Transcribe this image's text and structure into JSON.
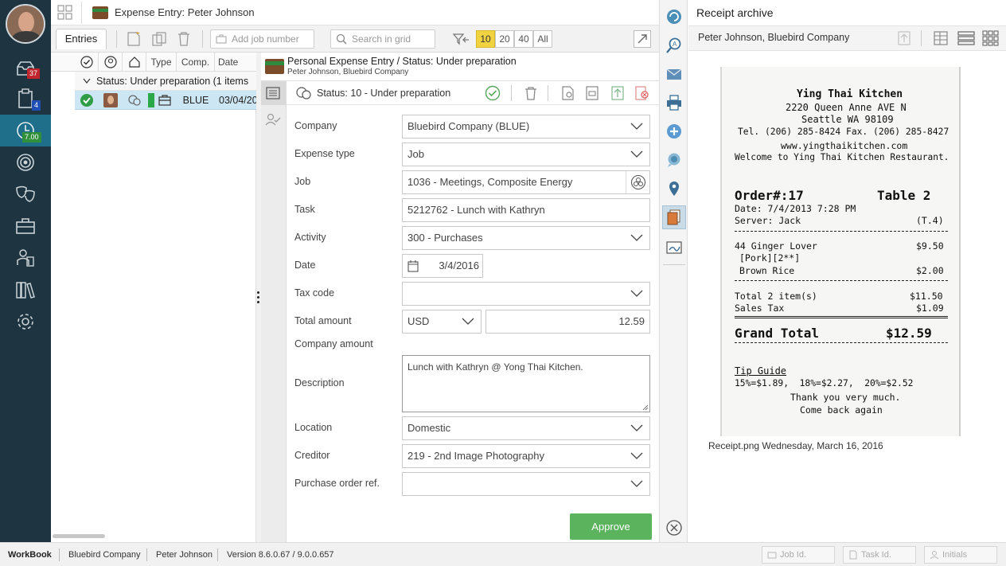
{
  "window": {
    "title": "Expense Entry: Peter Johnson"
  },
  "nav": {
    "items": [
      {
        "name": "inbox",
        "badge": "37",
        "badge_color": "#c0242d"
      },
      {
        "name": "clipboard",
        "badge": "4",
        "badge_color": "#1f4fb5"
      },
      {
        "name": "time",
        "badge": "7.00",
        "badge_color": "#2f8f3a",
        "active": true
      },
      {
        "name": "target"
      },
      {
        "name": "masks"
      },
      {
        "name": "briefcase"
      },
      {
        "name": "people"
      },
      {
        "name": "books"
      },
      {
        "name": "settings"
      }
    ]
  },
  "toolbar": {
    "entries_tab": "Entries",
    "add_job_placeholder": "Add job number",
    "search_placeholder": "Search in grid",
    "page_sizes": [
      "10",
      "20",
      "40",
      "All"
    ],
    "active_page_size": "10"
  },
  "grid": {
    "columns": [
      "Type",
      "Comp.",
      "Date"
    ],
    "group_label": "Status: Under preparation (1 items",
    "row": {
      "company": "BLUE",
      "date": "03/04/20"
    }
  },
  "form": {
    "header_title": "Personal Expense Entry / Status: Under preparation",
    "header_subtitle": "Peter Johnson, Bluebird Company",
    "status_text": "Status: 10 - Under preparation",
    "fields": {
      "company_label": "Company",
      "company_value": "Bluebird Company (BLUE)",
      "expense_type_label": "Expense type",
      "expense_type_value": "Job",
      "job_label": "Job",
      "job_value": "1036 - Meetings, Composite Energy",
      "task_label": "Task",
      "task_value": "5212762 - Lunch with Kathryn",
      "activity_label": "Activity",
      "activity_value": "300 - Purchases",
      "date_label": "Date",
      "date_value": "3/4/2016",
      "tax_code_label": "Tax code",
      "tax_code_value": "",
      "total_amount_label": "Total amount",
      "currency_value": "USD",
      "total_amount_value": "12.59",
      "company_amount_label": "Company amount",
      "description_label": "Description",
      "description_value": "Lunch with Kathryn @ Yong Thai Kitchen.",
      "location_label": "Location",
      "location_value": "Domestic",
      "creditor_label": "Creditor",
      "creditor_value": "219 - 2nd Image Photography",
      "po_label": "Purchase order ref.",
      "po_value": ""
    },
    "approve_label": "Approve"
  },
  "archive": {
    "title": "Receipt archive",
    "owner": "Peter Johnson, Bluebird Company",
    "caption": "Receipt.png Wednesday, March 16, 2016",
    "receipt": {
      "l1": "Ying Thai Kitchen",
      "l2": "2220 Queen Anne AVE N",
      "l3": "Seattle WA 98109",
      "l4": "Tel. (206) 285-8424 Fax. (206) 285-8427",
      "l5": "www.yingthaikitchen.com",
      "l6": "Welcome to Ying Thai Kitchen Restaurant.",
      "order": "Order#:17",
      "table": "Table 2",
      "date": "Date: 7/4/2013 7:28 PM",
      "server": "Server: Jack",
      "server_code": "(T.4)",
      "item1": "44 Ginger Lover",
      "item1_price": "$9.50",
      "item1_sub": "[Pork][2**]",
      "item2": "Brown Rice",
      "item2_price": "$2.00",
      "total_items": "Total 2 item(s)",
      "total_items_price": "$11.50",
      "tax": "Sales Tax",
      "tax_price": "$1.09",
      "grand": "Grand Total",
      "grand_price": "$12.59",
      "tip_title": "Tip Guide",
      "tip_line": "15%=$1.89,  18%=$2.27,  20%=$2.52",
      "thanks": "Thank you very much.",
      "come": "Come back again"
    }
  },
  "statusbar": {
    "app": "WorkBook",
    "company": "Bluebird Company",
    "user": "Peter Johnson",
    "version": "Version 8.6.0.67 / 9.0.0.657",
    "job_id_placeholder": "Job Id.",
    "task_id_placeholder": "Task Id.",
    "initials_placeholder": "Initials"
  }
}
